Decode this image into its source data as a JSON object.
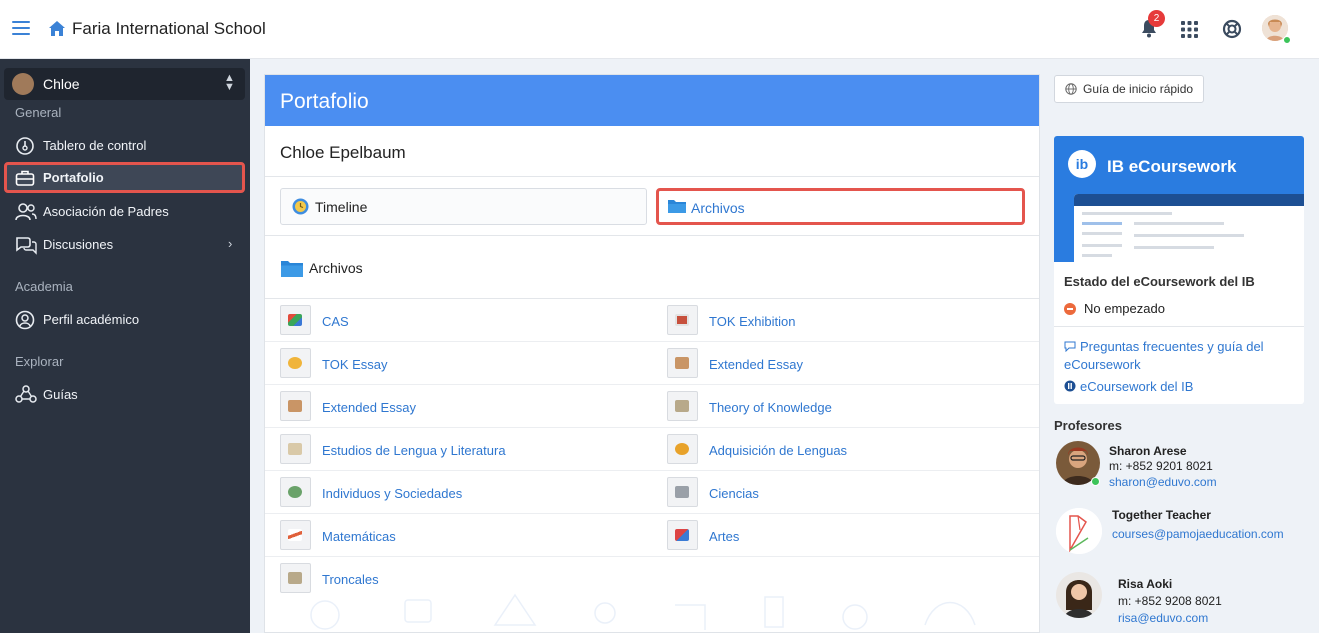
{
  "header": {
    "school_name": "Faria International School",
    "notification_count": "2"
  },
  "sidebar": {
    "user": "Chloe",
    "sections": {
      "general": "General",
      "academia": "Academia",
      "explorar": "Explorar"
    },
    "items": [
      {
        "label": "Tablero de control"
      },
      {
        "label": "Portafolio"
      },
      {
        "label": "Asociación de Padres"
      },
      {
        "label": "Discusiones"
      },
      {
        "label": "Perfil académico"
      },
      {
        "label": "Guías"
      }
    ]
  },
  "main": {
    "title": "Portafolio",
    "student": "Chloe Epelbaum",
    "tabs": [
      {
        "label": "Timeline"
      },
      {
        "label": "Archivos"
      }
    ],
    "folder_title": "Archivos",
    "files": [
      {
        "label": "CAS"
      },
      {
        "label": "TOK Exhibition"
      },
      {
        "label": "TOK Essay"
      },
      {
        "label": "Extended Essay"
      },
      {
        "label": "Extended Essay"
      },
      {
        "label": "Theory of Knowledge"
      },
      {
        "label": "Estudios de Lengua y Literatura"
      },
      {
        "label": "Adquisición de Lenguas"
      },
      {
        "label": "Individuos y Sociedades"
      },
      {
        "label": "Ciencias"
      },
      {
        "label": "Matemáticas"
      },
      {
        "label": "Artes"
      },
      {
        "label": "Troncales"
      }
    ]
  },
  "right": {
    "quick_guide": "Guía de inicio rápido",
    "ib_card": {
      "banner_title": "IB eCoursework",
      "status_title": "Estado del eCoursework del IB",
      "status": "No empezado",
      "faq_link": "Preguntas frecuentes y guía del eCoursework",
      "ib_link": "eCoursework del IB"
    },
    "teachers_title": "Profesores",
    "teachers": [
      {
        "name": "Sharon Arese",
        "phone": "m: +852 9201 8021",
        "email": "sharon@eduvo.com"
      },
      {
        "name": "Together Teacher",
        "email": "courses@pamojaeducation.com"
      },
      {
        "name": "Risa Aoki",
        "phone": "m: +852 9208 8021",
        "email": "risa@eduvo.com"
      }
    ]
  },
  "colors": {
    "accent_blue": "#4b8ef1",
    "sidebar_bg": "#2b3340",
    "highlight_red": "#e4554d",
    "link": "#2f77d0"
  }
}
